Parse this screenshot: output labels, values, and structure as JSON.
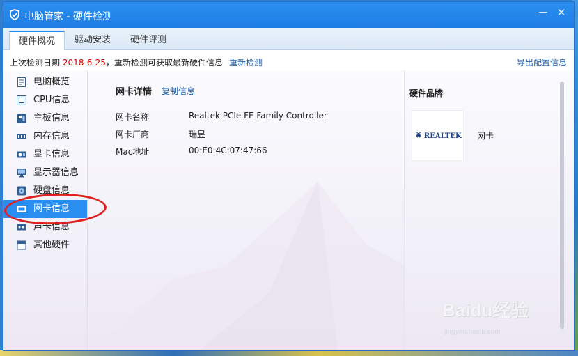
{
  "window": {
    "title": "电脑管家 - 硬件检测",
    "minimize_glyph": "—",
    "close_glyph": "✕"
  },
  "tabs": [
    {
      "label": "硬件概况",
      "active": true
    },
    {
      "label": "驱动安装",
      "active": false
    },
    {
      "label": "硬件评测",
      "active": false
    }
  ],
  "status": {
    "prefix": "上次检测日期 ",
    "date": "2018-6-25",
    "suffix": "，重新检测可获取最新硬件信息",
    "recheck_label": "重新检测",
    "export_label": "导出配置信息"
  },
  "sidebar": {
    "items": [
      {
        "label": "电脑概览",
        "icon": "clipboard-icon"
      },
      {
        "label": "CPU信息",
        "icon": "cpu-icon"
      },
      {
        "label": "主板信息",
        "icon": "motherboard-icon"
      },
      {
        "label": "内存信息",
        "icon": "memory-icon"
      },
      {
        "label": "显卡信息",
        "icon": "graphics-card-icon"
      },
      {
        "label": "显示器信息",
        "icon": "monitor-icon"
      },
      {
        "label": "硬盘信息",
        "icon": "hard-disk-icon"
      },
      {
        "label": "网卡信息",
        "icon": "network-card-icon",
        "active": true
      },
      {
        "label": "声卡信息",
        "icon": "sound-card-icon"
      },
      {
        "label": "其他硬件",
        "icon": "other-hardware-icon"
      }
    ]
  },
  "detail": {
    "title": "网卡详情",
    "copy_label": "复制信息",
    "rows": [
      {
        "label": "网卡名称",
        "value": "Realtek PCIe FE Family Controller"
      },
      {
        "label": "网卡厂商",
        "value": "瑞昱"
      },
      {
        "label": "Mac地址",
        "value": "00:E0:4C:07:47:66"
      }
    ]
  },
  "brand": {
    "title": "硬件品牌",
    "logo_text": "REALTEK",
    "name": "网卡"
  },
  "watermark": {
    "main": "Baidu经验",
    "sub": "jingyan.baidu.com"
  },
  "colors": {
    "titlebar": "#1e7ee4",
    "accent": "#2a8ef0",
    "link": "#1f5fa8",
    "date": "#d40000",
    "annotation": "#e02020"
  }
}
